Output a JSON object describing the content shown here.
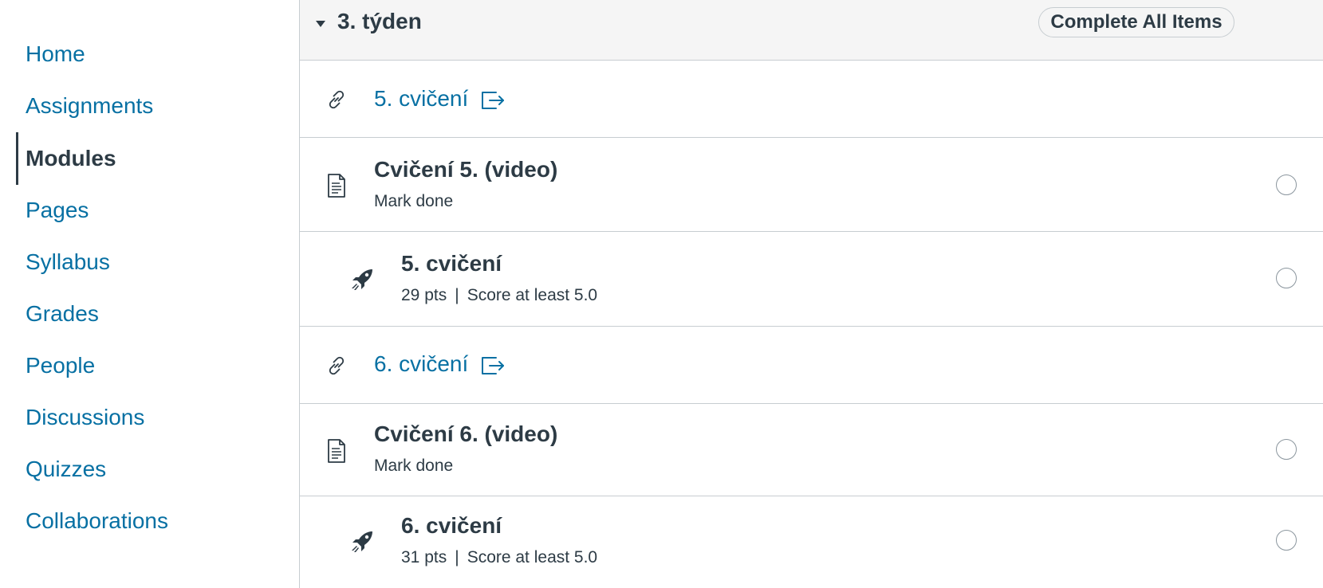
{
  "nav": {
    "items": [
      {
        "label": "Home"
      },
      {
        "label": "Assignments"
      },
      {
        "label": "Modules",
        "active": true
      },
      {
        "label": "Pages"
      },
      {
        "label": "Syllabus"
      },
      {
        "label": "Grades"
      },
      {
        "label": "People"
      },
      {
        "label": "Discussions"
      },
      {
        "label": "Quizzes"
      },
      {
        "label": "Collaborations"
      }
    ]
  },
  "module": {
    "title": "3. týden",
    "complete_all_label": "Complete All Items",
    "items": [
      {
        "type": "external-link",
        "title": "5. cvičení",
        "icon": "link-icon"
      },
      {
        "type": "page",
        "title": "Cvičení 5. (video)",
        "requirement": "Mark done",
        "icon": "document-icon"
      },
      {
        "type": "quiz",
        "title": "5. cvičení",
        "points": "29 pts",
        "separator": "|",
        "requirement": "Score at least 5.0",
        "icon": "rocket-icon"
      },
      {
        "type": "external-link",
        "title": "6. cvičení",
        "icon": "link-icon"
      },
      {
        "type": "page",
        "title": "Cvičení 6. (video)",
        "requirement": "Mark done",
        "icon": "document-icon"
      },
      {
        "type": "quiz",
        "title": "6. cvičení",
        "points": "31 pts",
        "separator": "|",
        "requirement": "Score at least 5.0",
        "icon": "rocket-icon"
      }
    ]
  },
  "colors": {
    "link": "#0770a3",
    "text": "#2d3b45",
    "border": "#c7cdd1",
    "header_bg": "#f5f5f5"
  }
}
